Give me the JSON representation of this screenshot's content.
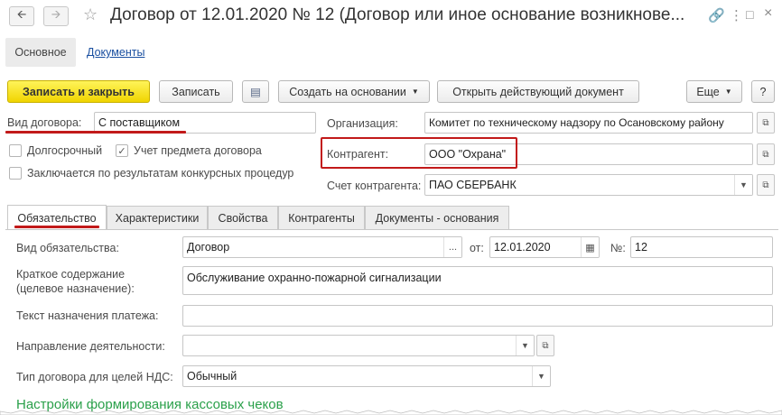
{
  "titlebar": {
    "back_icon": "arrow-left",
    "forward_icon": "arrow-right",
    "star_icon": "star",
    "title": "Договор от 12.01.2020 № 12 (Договор или иное основание возникнове...",
    "link_icon": "link",
    "menu_icon": "vertical-dots",
    "maximize_icon": "square",
    "close_icon": "x"
  },
  "top_tabs": {
    "main": "Основное",
    "documents": "Документы"
  },
  "toolbar": {
    "save_close": "Записать и закрыть",
    "save": "Записать",
    "list_icon": "list",
    "create_based": "Создать на основании",
    "open_doc": "Открыть действующий документ",
    "more": "Еще",
    "help": "?"
  },
  "form": {
    "contract_type_label": "Вид договора:",
    "contract_type_value": "С поставщиком",
    "long_term_label": "Долгосрочный",
    "long_term_checked": false,
    "subject_accounting_label": "Учет предмета договора",
    "subject_accounting_checked": true,
    "tender_label": "Заключается по результатам конкурсных процедур",
    "tender_checked": false,
    "organization_label": "Организация:",
    "organization_value": "Комитет по техническому надзору по Осановскому району",
    "counterparty_label": "Контрагент:",
    "counterparty_value": "ООО \"Охрана\"",
    "account_label": "Счет контрагента:",
    "account_value": "ПАО СБЕРБАНК"
  },
  "tabs": [
    {
      "label": "Обязательство",
      "active": true
    },
    {
      "label": "Характеристики",
      "active": false
    },
    {
      "label": "Свойства",
      "active": false
    },
    {
      "label": "Контрагенты",
      "active": false
    },
    {
      "label": "Документы - основания",
      "active": false
    }
  ],
  "obligation": {
    "kind_label": "Вид обязательства:",
    "kind_value": "Договор",
    "from_label": "от:",
    "date_value": "12.01.2020",
    "number_label": "№:",
    "number_value": "12",
    "summary_label_1": "Краткое содержание",
    "summary_label_2": "(целевое назначение):",
    "summary_value": "Обслуживание охранно-пожарной сигнализации",
    "payment_text_label": "Текст назначения платежа:",
    "payment_text_value": "",
    "activity_label": "Направление деятельности:",
    "activity_value": "",
    "vat_type_label": "Тип договора для целей НДС:",
    "vat_type_value": "Обычный",
    "cash_receipts_link": "Настройки формирования кассовых чеков"
  },
  "colors": {
    "accent_yellow": "#f5dc00",
    "highlight_red": "#c21a1a",
    "link_blue": "#1a4fa0",
    "link_green": "#2aa04a"
  }
}
